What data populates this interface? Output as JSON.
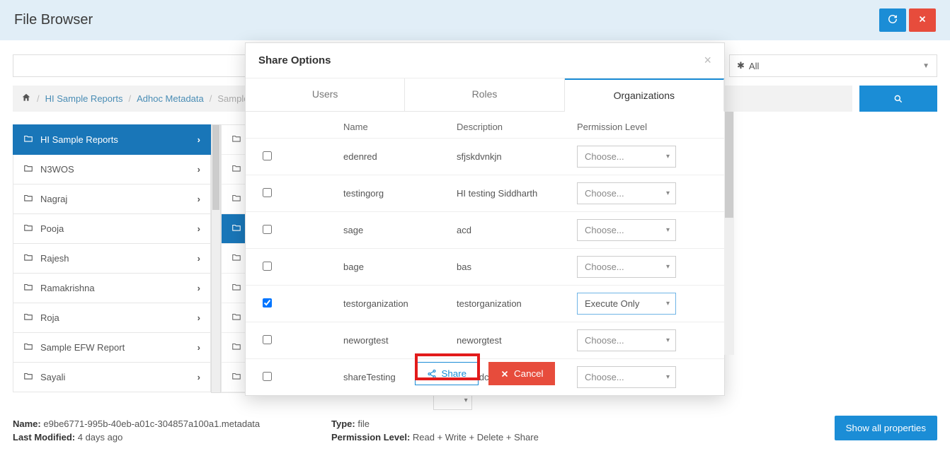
{
  "header": {
    "title": "File Browser"
  },
  "topbar": {
    "filter_label": "All"
  },
  "breadcrumb": {
    "root": "HI Sample Reports",
    "mid": "Adhoc Metadata",
    "current": "Sample Travel M"
  },
  "sidebar": {
    "items": [
      {
        "label": "HI Sample Reports",
        "active": true
      },
      {
        "label": "N3WOS"
      },
      {
        "label": "Nagraj"
      },
      {
        "label": "Pooja"
      },
      {
        "label": "Rajesh"
      },
      {
        "label": "Ramakrishna"
      },
      {
        "label": "Roja"
      },
      {
        "label": "Sample EFW Report"
      },
      {
        "label": "Sayali"
      }
    ]
  },
  "midcol": {
    "rows_visible": 9,
    "selector_placeholder": ""
  },
  "details": {
    "name_label": "Name:",
    "name_value": "e9be6771-995b-40eb-a01c-304857a100a1.metadata",
    "modified_label": "Last Modified:",
    "modified_value": "4 days ago",
    "type_label": "Type:",
    "type_value": "file",
    "perm_label": "Permission Level:",
    "perm_value": "Read + Write + Delete + Share",
    "show_all": "Show all properties"
  },
  "modal": {
    "title": "Share Options",
    "tabs": {
      "users": "Users",
      "roles": "Roles",
      "orgs": "Organizations"
    },
    "headers": {
      "name": "Name",
      "desc": "Description",
      "perm": "Permission Level"
    },
    "choose": "Choose...",
    "rows": [
      {
        "name": "edenred",
        "desc": "sfjskdvnkjn",
        "checked": false,
        "perm": "Choose..."
      },
      {
        "name": "testingorg",
        "desc": "HI testing Siddharth",
        "checked": false,
        "perm": "Choose..."
      },
      {
        "name": "sage",
        "desc": "acd",
        "checked": false,
        "perm": "Choose..."
      },
      {
        "name": "bage",
        "desc": "bas",
        "checked": false,
        "perm": "Choose..."
      },
      {
        "name": "testorganization",
        "desc": "testorganization",
        "checked": true,
        "perm": "Execute Only",
        "active": true
      },
      {
        "name": "neworgtest",
        "desc": "neworgtest",
        "checked": false,
        "perm": "Choose..."
      },
      {
        "name": "shareTesting",
        "desc": "dmsadcm",
        "checked": false,
        "perm": "Choose..."
      }
    ],
    "share": "Share",
    "cancel": "Cancel"
  }
}
